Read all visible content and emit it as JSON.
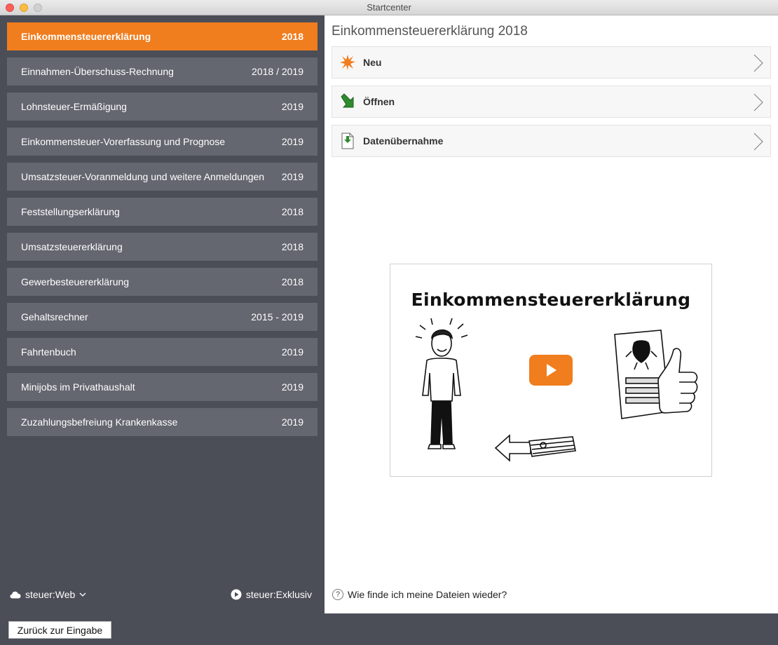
{
  "window": {
    "title": "Startcenter"
  },
  "sidebar": {
    "items": [
      {
        "label": "Einkommensteuererklärung",
        "year": "2018"
      },
      {
        "label": "Einnahmen-Überschuss-Rechnung",
        "year": "2018 / 2019"
      },
      {
        "label": "Lohnsteuer-Ermäßigung",
        "year": "2019"
      },
      {
        "label": "Einkommensteuer-Vorerfassung und Prognose",
        "year": "2019"
      },
      {
        "label": "Umsatzsteuer-Voranmeldung und weitere Anmeldungen",
        "year": "2019"
      },
      {
        "label": "Feststellungserklärung",
        "year": "2018"
      },
      {
        "label": "Umsatzsteuererklärung",
        "year": "2018"
      },
      {
        "label": "Gewerbesteuererklärung",
        "year": "2018"
      },
      {
        "label": "Gehaltsrechner",
        "year": "2015 - 2019"
      },
      {
        "label": "Fahrtenbuch",
        "year": "2019"
      },
      {
        "label": "Minijobs im Privathaushalt",
        "year": "2019"
      },
      {
        "label": "Zuzahlungsbefreiung Krankenkasse",
        "year": "2019"
      }
    ],
    "active_index": 0,
    "footer": {
      "web_label": "steuer:Web",
      "exklusiv_label": "steuer:Exklusiv"
    }
  },
  "main": {
    "title": "Einkommensteuererklärung 2018",
    "actions": [
      {
        "label": "Neu",
        "icon": "starburst-icon"
      },
      {
        "label": "Öffnen",
        "icon": "open-arrow-icon"
      },
      {
        "label": "Datenübernahme",
        "icon": "data-import-icon"
      }
    ],
    "video": {
      "title": "Einkommensteuererklärung"
    },
    "help_text": "Wie finde ich meine Dateien wieder?"
  },
  "bottombar": {
    "back_label": "Zurück zur Eingabe"
  },
  "colors": {
    "accent": "#f07d1e",
    "sidebar_bg": "#4b4e57",
    "item_bg": "#646770"
  }
}
